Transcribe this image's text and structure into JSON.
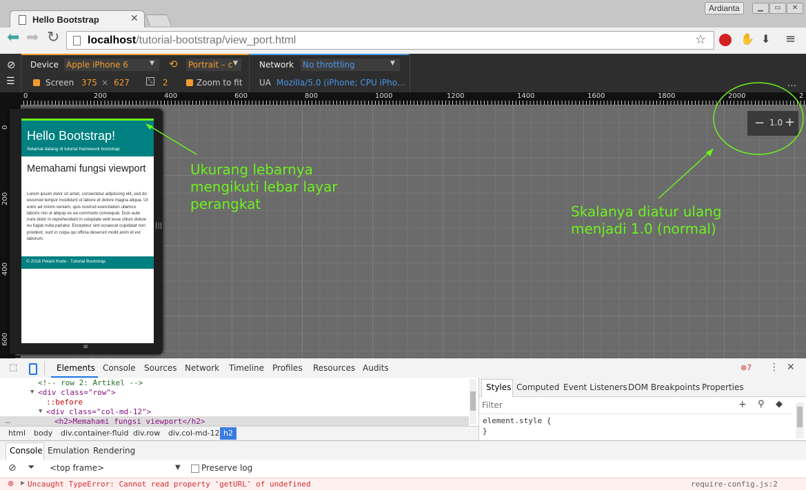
{
  "browser": {
    "tab_title": "Hello Bootstrap",
    "user_name": "Ardianta",
    "url_host": "localhost",
    "url_path": "/tutorial-bootstrap/view_port.html"
  },
  "device_bar": {
    "device_label": "Device",
    "device_value": "Apple iPhone 6",
    "orientation_value": "Portrait – c",
    "network_label": "Network",
    "network_value": "No throttling",
    "screen_label": "Screen",
    "screen_width": "375",
    "times": "×",
    "screen_height": "627",
    "dpr_value": "2",
    "zoom_to_fit_label": "Zoom to fit",
    "ua_label": "UA",
    "ua_value": "Mozilla/5.0 (iPhone; CPU iPho…",
    "more": "⋮"
  },
  "rulers": {
    "h_ticks": [
      "0",
      "200",
      "400",
      "600",
      "800",
      "1000",
      "1200",
      "1400",
      "1600",
      "1800",
      "2000",
      "2"
    ],
    "v_ticks": [
      "0",
      "200",
      "400",
      "600"
    ]
  },
  "page": {
    "header_title": "Hello Bootstrap!",
    "header_subtitle": "Selamat datang di tutorial framework bootstrap",
    "article_heading": "Memahami fungsi viewport",
    "article_body": "Lorem ipsum dolor sit amet, consectetur adipiscing elit, sed do eiusmod tempor incididunt ut labore et dolore magna aliqua. Ut enim ad minim veniam, quis nostrud exercitation ullamco laboris nisi ut aliquip ex ea commodo consequat. Duis aute irure dolor in reprehenderit in voluptate velit esse cillum dolore eu fugiat nulla pariatur. Excepteur sint occaecat cupidatat non proident, sunt in culpa qui officia deserunt mollit anim id est laborum.",
    "footer_text": "© 2016 Petani Kode - Tutorial Bootstrap"
  },
  "zoom": {
    "value": "1.0",
    "minus": "−",
    "plus": "+"
  },
  "annotations": {
    "left_line1": "Ukurang lebarnya",
    "left_line2": "mengikuti lebar layar",
    "left_line3": "perangkat",
    "right_line1": "Skalanya diatur ulang",
    "right_line2": "menjadi 1.0 (normal)",
    "color": "#6cf21e"
  },
  "devtools": {
    "tabs": [
      "Elements",
      "Console",
      "Sources",
      "Network",
      "Timeline",
      "Profiles",
      "Resources",
      "Audits"
    ],
    "active_tab": "Elements",
    "error_count": "7",
    "dom_lines": [
      "<!-- row 2: Artikel -->",
      "<div class=\"row\">",
      "::before",
      "<div class=\"col-md-12\">",
      "<h2>Memahami fungsi viewport</h2>"
    ],
    "breadcrumbs": [
      "html",
      "body",
      "div.container-fluid",
      "div.row",
      "div.col-md-12",
      "h2"
    ],
    "style_tabs": [
      "Styles",
      "Computed",
      "Event Listeners",
      "DOM Breakpoints",
      "Properties"
    ],
    "filter_placeholder": "Filter",
    "element_style_open": "element.style {",
    "element_style_close": "}",
    "drawer_tabs": [
      "Console",
      "Emulation",
      "Rendering"
    ],
    "frame_select": "<top frame>",
    "preserve_log": "Preserve log",
    "error_message": "Uncaught TypeError: Cannot read property 'getURL' of undefined",
    "error_source": "require-config.js:2"
  }
}
